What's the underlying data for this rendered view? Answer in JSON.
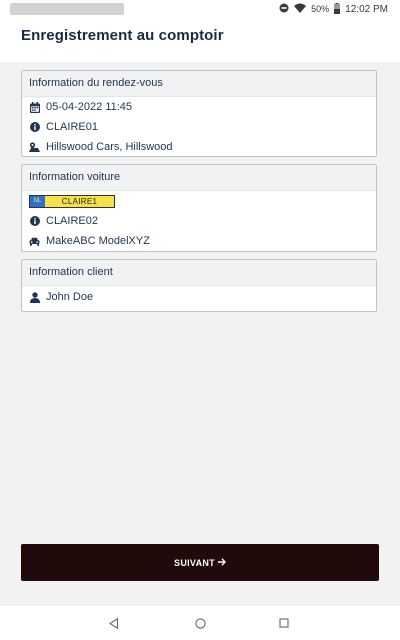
{
  "status_bar": {
    "battery": "50%",
    "time": "12:02 PM",
    "icons": [
      "do-not-disturb-icon",
      "wifi-icon",
      "battery-icon"
    ]
  },
  "header": {
    "title": "Enregistrement au comptoir"
  },
  "appointment": {
    "title": "Information du rendez-vous",
    "datetime": "05-04-2022 11:45",
    "reference": "CLAIRE01",
    "location": "Hillswood Cars, Hillswood"
  },
  "car": {
    "title": "Information voiture",
    "plate_country": "NL",
    "plate_number": "CLAIRE1",
    "reference": "CLAIRE02",
    "model": "MakeABC ModelXYZ"
  },
  "client": {
    "title": "Information client",
    "name": "John Doe"
  },
  "footer": {
    "next_label": "SUIVANT",
    "next_icon": "arrow-right-icon"
  },
  "nav": {
    "icons": [
      "back-icon",
      "home-icon",
      "recents-icon"
    ]
  },
  "colors": {
    "primary_text": "#1f3550",
    "button_bg": "#200a0a",
    "plate_yellow": "#f5e14a",
    "plate_blue": "#2f6fd0"
  }
}
